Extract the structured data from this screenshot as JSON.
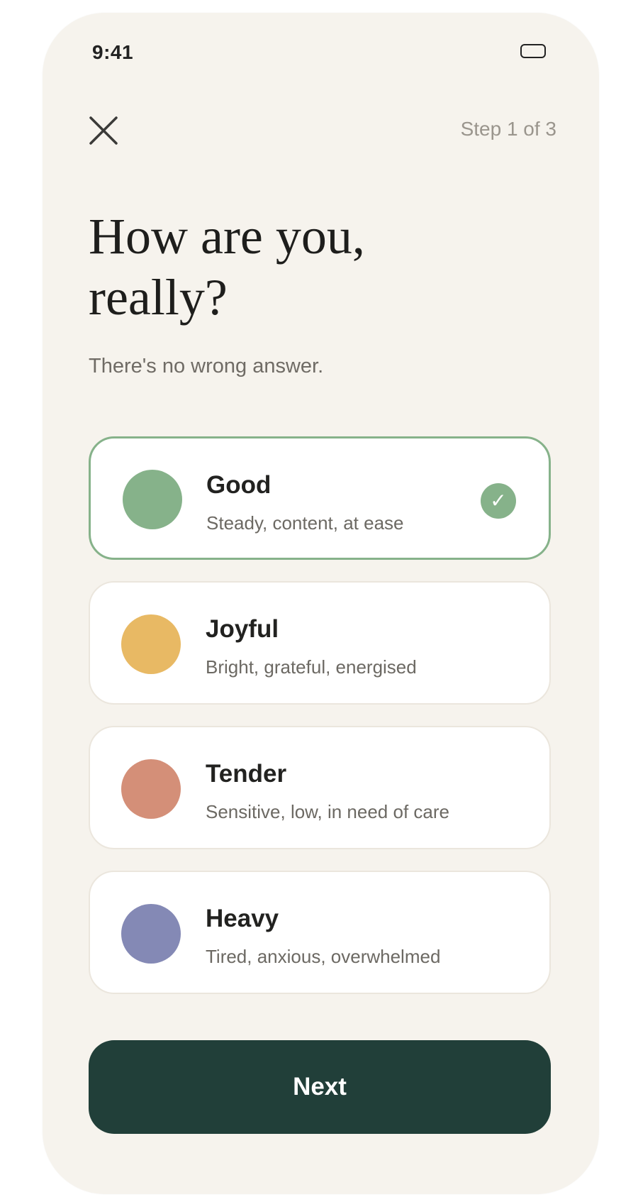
{
  "status_bar": {
    "time": "9:41",
    "battery_icon": "battery-icon"
  },
  "header": {
    "close_icon": "close-icon",
    "step_label": "Step 1 of 3"
  },
  "title": "How are you, really?",
  "subtitle": "There's no wrong answer.",
  "options": [
    {
      "title": "Good",
      "description": "Steady, content, at ease",
      "color": "#86b28a",
      "selected": true
    },
    {
      "title": "Joyful",
      "description": "Bright, grateful, energised",
      "color": "#e8b964",
      "selected": false
    },
    {
      "title": "Tender",
      "description": "Sensitive, low, in need of care",
      "color": "#d48f78",
      "selected": false
    },
    {
      "title": "Heavy",
      "description": "Tired, anxious, overwhelmed",
      "color": "#8489b5",
      "selected": false
    }
  ],
  "check_glyph": "✓",
  "next_label": "Next",
  "colors": {
    "background": "#f6f3ed",
    "primary_button": "#213f39",
    "accent": "#86b28a"
  }
}
